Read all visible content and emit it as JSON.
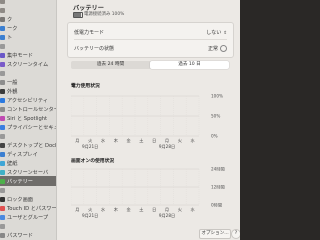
{
  "sidebar": {
    "items": [
      {
        "label": "",
        "color": "#8e8a86"
      },
      {
        "label": "",
        "color": "#8e8a86"
      },
      {
        "label": "ク",
        "color": "#7a7775"
      },
      {
        "label": "ーク",
        "color": "#3b7fd1"
      },
      {
        "label": "ト",
        "color": "#3b7fd1"
      },
      {
        "label": "",
        "color": "#999"
      },
      {
        "label": "集中モード",
        "color": "#6a58c8"
      },
      {
        "label": "スクリーンタイム",
        "color": "#7a5bc9"
      },
      {
        "label": "",
        "color": "#999"
      },
      {
        "label": "一般",
        "color": "#8d8d8d"
      },
      {
        "label": "外観",
        "color": "#3c3c3c"
      },
      {
        "label": "アクセシビリティ",
        "color": "#2c7ae0"
      },
      {
        "label": "コントロールセンター",
        "color": "#8d8d8d"
      },
      {
        "label": "Siri と Spotlight",
        "color": "#c04ab2"
      },
      {
        "label": "プライバシーとセキュリティ",
        "color": "#3a7ee0"
      },
      {
        "label": "",
        "color": "#999"
      },
      {
        "label": "デスクトップと Dock",
        "color": "#444"
      },
      {
        "label": "ディスプレイ",
        "color": "#3b7fd1"
      },
      {
        "label": "壁紙",
        "color": "#3fa6d6"
      },
      {
        "label": "スクリーンセーバ",
        "color": "#3fb0c6"
      },
      {
        "label": "バッテリー",
        "color": "#4cb04a"
      },
      {
        "label": "",
        "color": "#999"
      },
      {
        "label": "ロック画面",
        "color": "#333"
      },
      {
        "label": "Touch ID とパスワード",
        "color": "#e05050"
      },
      {
        "label": "ユーザとグループ",
        "color": "#4a8ae0"
      },
      {
        "label": "",
        "color": "#999"
      },
      {
        "label": "パスワード",
        "color": "#888"
      }
    ],
    "selected_index": 20
  },
  "header": {
    "title": "バッテリー",
    "status": "電源接続済み 100%"
  },
  "settings": {
    "low_power_label": "低電力モード",
    "low_power_value": "しない",
    "battery_health_label": "バッテリーの状態",
    "battery_health_value": "正常"
  },
  "segment": {
    "options": [
      "過去 24 時間",
      "過去 10 日"
    ],
    "active_index": 1
  },
  "battery_chart": {
    "title": "電力使用状況",
    "y_labels": [
      "100%",
      "50%",
      "0%"
    ],
    "day_labels": [
      "月",
      "火",
      "水",
      "木",
      "金",
      "土",
      "日",
      "月",
      "火",
      "水"
    ],
    "date_labels": [
      "9月21日",
      "9月28日"
    ]
  },
  "screen_chart": {
    "title": "画面オンの使用状況",
    "y_labels": [
      "24時間",
      "12時間",
      "0時間"
    ],
    "day_labels": [
      "月",
      "火",
      "水",
      "木",
      "金",
      "土",
      "日",
      "月",
      "火",
      "水"
    ],
    "date_labels": [
      "9月21日",
      "9月28日"
    ]
  },
  "footer": {
    "options_label": "オプション...",
    "help_label": "?"
  }
}
